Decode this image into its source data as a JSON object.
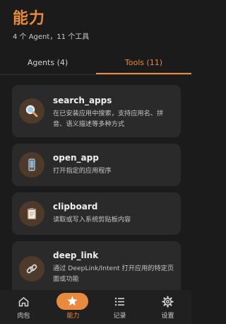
{
  "header": {
    "title": "能力",
    "subtitle": "4 个 Agent，11 个工具"
  },
  "tabs": [
    {
      "label": "Agents (4)",
      "selected": false
    },
    {
      "label": "Tools (11)",
      "selected": true
    }
  ],
  "tools": [
    {
      "name": "search_apps",
      "description": "在已安装应用中搜索，支持应用名、拼音、语义描述等多种方式",
      "icon": "search-icon"
    },
    {
      "name": "open_app",
      "description": "打开指定的应用程序",
      "icon": "phone-icon"
    },
    {
      "name": "clipboard",
      "description": "读取或写入系统剪贴板内容",
      "icon": "clipboard-icon"
    },
    {
      "name": "deep_link",
      "description": "通过 DeepLink/Intent 打开应用的特定页面或功能",
      "icon": "link-icon"
    }
  ],
  "bottom_nav": [
    {
      "label": "肉包",
      "icon": "home-icon",
      "selected": false
    },
    {
      "label": "能力",
      "icon": "star-icon",
      "selected": true
    },
    {
      "label": "记录",
      "icon": "list-icon",
      "selected": false
    },
    {
      "label": "设置",
      "icon": "gear-icon",
      "selected": false
    }
  ],
  "colors": {
    "accent": "#e98a3e",
    "background": "#1b1b1b",
    "card": "#2a2a2a",
    "icon_circle": "#4e3a2a"
  }
}
